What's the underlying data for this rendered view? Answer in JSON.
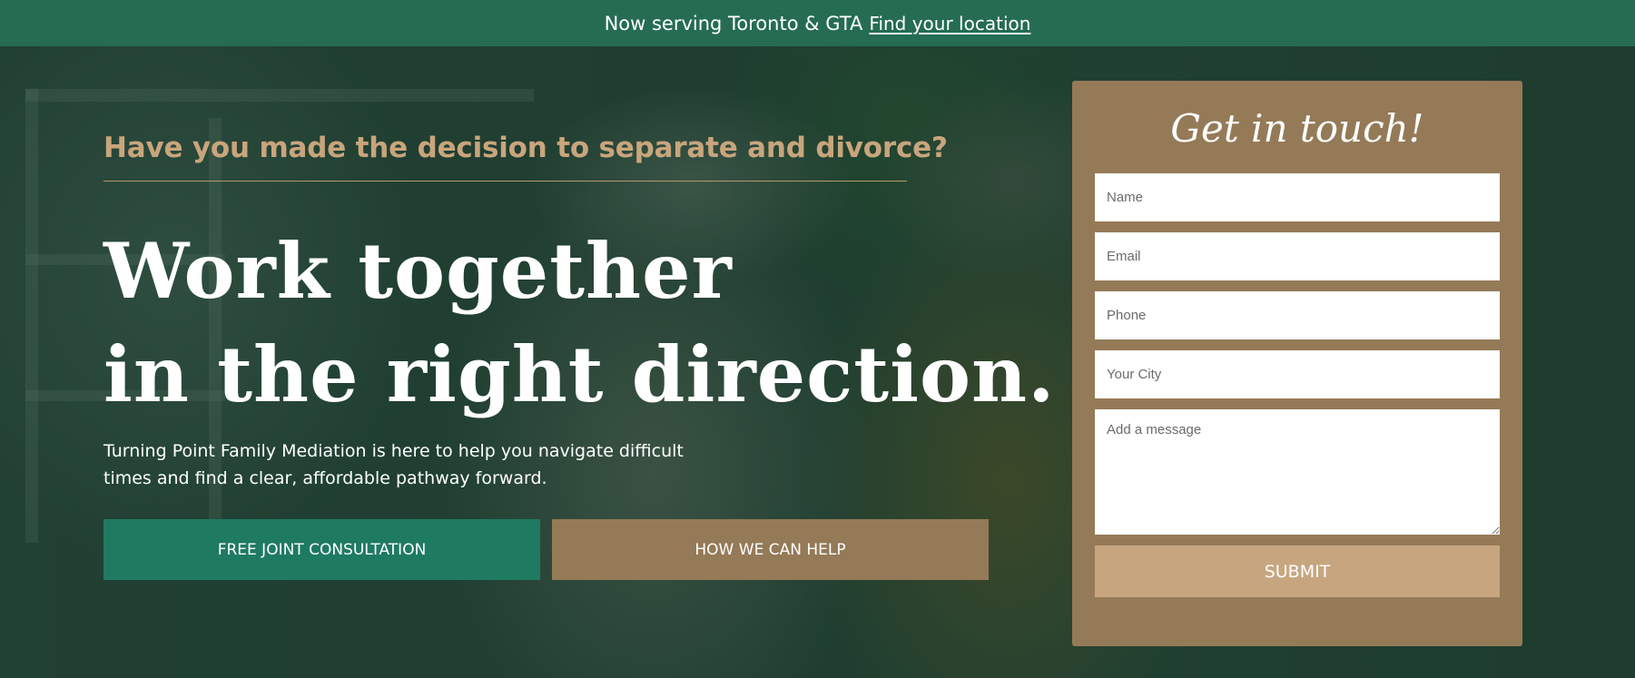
{
  "announcement": {
    "text": "Now serving Toronto & GTA",
    "link_label": "Find your location"
  },
  "hero": {
    "eyebrow": "Have you made the decision to separate and divorce?",
    "headline_line1": "Work together",
    "headline_line2": "in the right direction.",
    "intro": "Turning Point Family Mediation is here to help you navigate difficult times and find a clear, affordable pathway forward.",
    "cta_primary": "FREE JOINT CONSULTATION",
    "cta_secondary": "HOW WE CAN HELP"
  },
  "contact_form": {
    "title": "Get in touch!",
    "name_placeholder": "Name",
    "email_placeholder": "Email",
    "phone_placeholder": "Phone",
    "city_placeholder": "Your City",
    "message_placeholder": "Add a message",
    "submit_label": "SUBMIT"
  },
  "colors": {
    "brand_green": "#1f7a62",
    "brand_brown": "#957a58",
    "accent_gold": "#c9a57c",
    "submit_tan": "#c7a67f"
  }
}
